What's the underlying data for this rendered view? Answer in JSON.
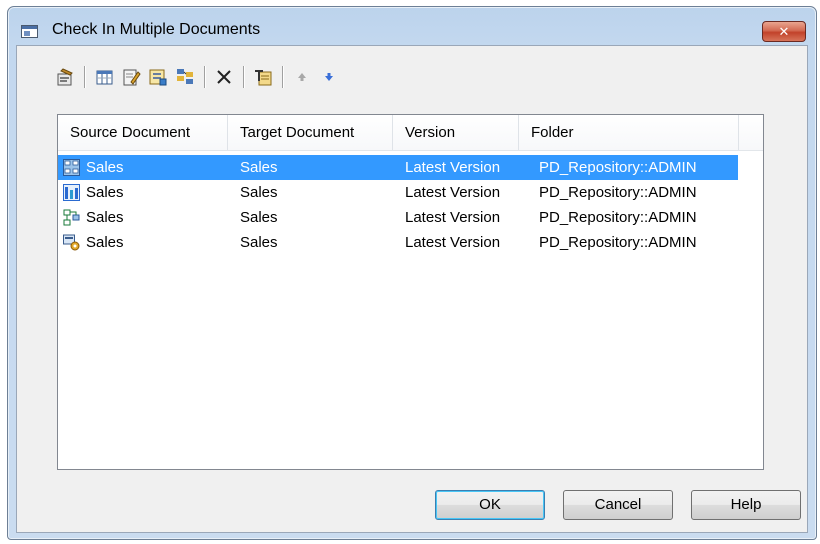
{
  "window": {
    "title": "Check In Multiple Documents",
    "close_label": "✕"
  },
  "toolbar": {
    "buttons": [
      {
        "name": "properties-icon"
      },
      {
        "name": "select-columns-icon"
      },
      {
        "name": "edit-icon"
      },
      {
        "name": "add-document-icon"
      },
      {
        "name": "add-model-icon"
      },
      {
        "name": "delete-icon"
      },
      {
        "name": "find-icon"
      },
      {
        "name": "move-up-icon"
      },
      {
        "name": "move-down-icon"
      }
    ]
  },
  "list": {
    "columns": [
      "Source Document",
      "Target Document",
      "Version",
      "Folder"
    ],
    "rows": [
      {
        "icon": "data-model-icon",
        "source": "Sales",
        "target": "Sales",
        "version": "Latest Version",
        "folder": "PD_Repository::ADMIN",
        "selected": true
      },
      {
        "icon": "business-model-icon",
        "source": "Sales",
        "target": "Sales",
        "version": "Latest Version",
        "folder": "PD_Repository::ADMIN",
        "selected": false
      },
      {
        "icon": "process-model-icon",
        "source": "Sales",
        "target": "Sales",
        "version": "Latest Version",
        "folder": "PD_Repository::ADMIN",
        "selected": false
      },
      {
        "icon": "deployment-model-icon",
        "source": "Sales",
        "target": "Sales",
        "version": "Latest Version",
        "folder": "PD_Repository::ADMIN",
        "selected": false
      }
    ]
  },
  "buttons": {
    "ok": "OK",
    "cancel": "Cancel",
    "help": "Help"
  },
  "colors": {
    "selection": "#3399ff",
    "title_bar": "#c3d8ef"
  }
}
